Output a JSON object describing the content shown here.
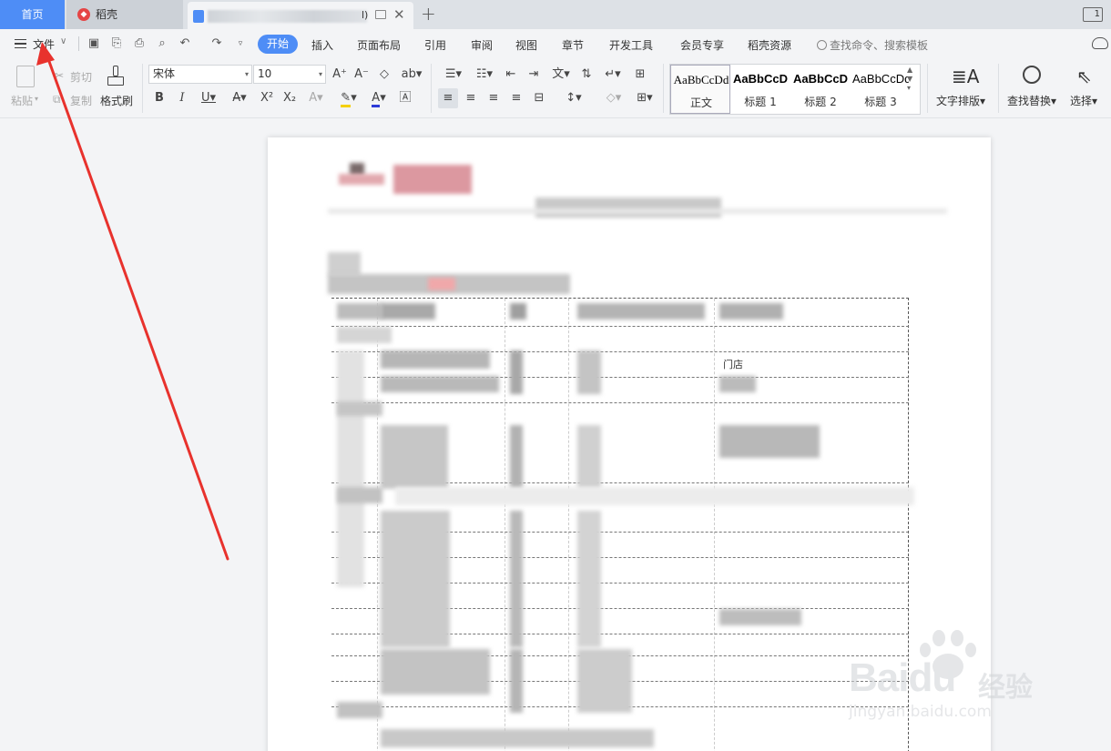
{
  "tabs": {
    "home": "首页",
    "daoke": "稻壳",
    "doc_suffix": "l)",
    "window_badge": "1"
  },
  "menu": {
    "file": "文件",
    "items": [
      "开始",
      "插入",
      "页面布局",
      "引用",
      "审阅",
      "视图",
      "章节",
      "开发工具",
      "会员专享",
      "稻壳资源"
    ],
    "search": "查找命令、搜索模板"
  },
  "ribbon": {
    "paste": "粘贴",
    "cut": "剪切",
    "copy": "复制",
    "format_painter": "格式刷",
    "font_name": "宋体",
    "font_size": "10",
    "styles": [
      {
        "sample": "AaBbCcDd",
        "name": "正文"
      },
      {
        "sample": "AaBbCcD",
        "name": "标题 1"
      },
      {
        "sample": "AaBbCcD",
        "name": "标题 2"
      },
      {
        "sample": "AaBbCcDd",
        "name": "标题 3"
      }
    ],
    "text_layout": "文字排版",
    "find_replace": "查找替换",
    "select": "选择"
  },
  "document": {
    "visible_fragment": "门店"
  },
  "watermark": {
    "brand": "Baidu",
    "cn": "经验",
    "url": "jingyan.baidu.com"
  },
  "colors": {
    "accent": "#4e8df6",
    "arrow": "#e8322d"
  }
}
